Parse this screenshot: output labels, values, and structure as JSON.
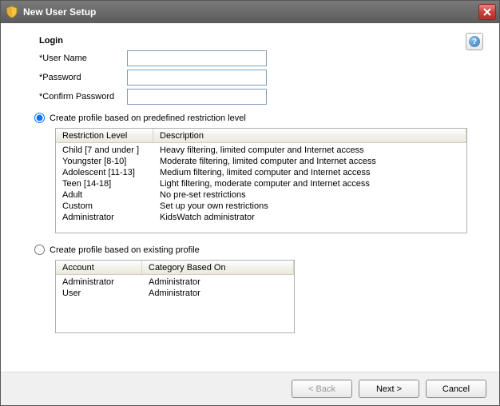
{
  "window": {
    "title": "New User Setup"
  },
  "help_tooltip": "?",
  "login": {
    "heading": "Login",
    "username_label": "*User Name",
    "username_value": "",
    "password_label": "*Password",
    "password_value": "",
    "confirm_label": "*Confirm Password",
    "confirm_value": ""
  },
  "option_predefined": {
    "label": "Create profile based on predefined restriction level",
    "selected": true,
    "headers": {
      "level": "Restriction Level",
      "description": "Description"
    },
    "rows": [
      {
        "level": "Child [7 and under ]",
        "description": "Heavy filtering, limited computer and Internet access"
      },
      {
        "level": "Youngster [8-10]",
        "description": "Moderate filtering, limited computer and Internet access"
      },
      {
        "level": "Adolescent [11-13]",
        "description": "Medium filtering, limited computer and Internet access"
      },
      {
        "level": "Teen [14-18]",
        "description": "Light filtering, moderate computer and Internet access"
      },
      {
        "level": "Adult",
        "description": "No pre-set restrictions"
      },
      {
        "level": "Custom",
        "description": "Set up your own restrictions"
      },
      {
        "level": "Administrator",
        "description": "KidsWatch administrator"
      }
    ]
  },
  "option_existing": {
    "label": "Create profile based on existing profile",
    "selected": false,
    "headers": {
      "account": "Account",
      "category": "Category Based On"
    },
    "rows": [
      {
        "account": "Administrator",
        "category": "Administrator"
      },
      {
        "account": "User",
        "category": "Administrator"
      }
    ]
  },
  "buttons": {
    "back": "< Back",
    "next": "Next >",
    "cancel": "Cancel"
  }
}
